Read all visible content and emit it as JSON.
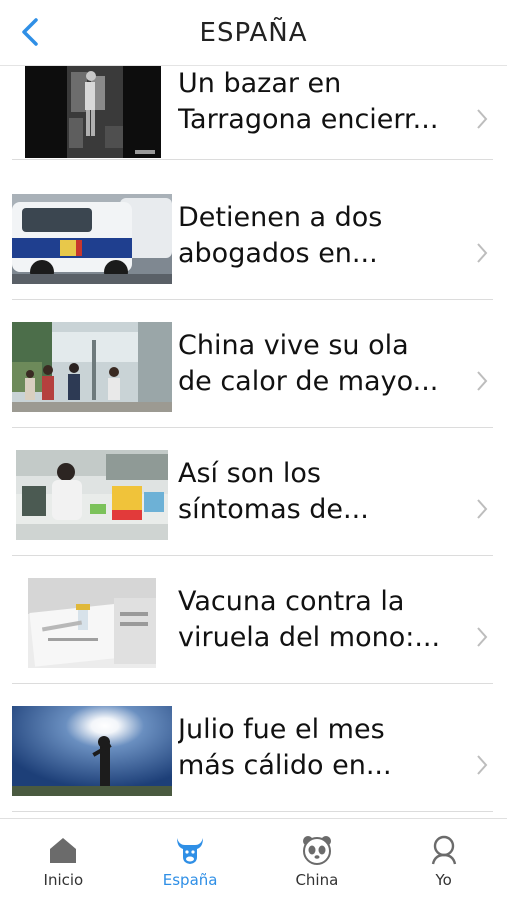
{
  "header": {
    "title": "ESPAÑA",
    "back_icon": "chevron-left-icon",
    "accent": "#2f8fe6"
  },
  "articles": [
    {
      "line1": "Un bazar en",
      "line2": "Tarragona encierr..."
    },
    {
      "line1": "Detienen a dos",
      "line2": "abogados en..."
    },
    {
      "line1": "China vive su ola",
      "line2": "de calor de mayo..."
    },
    {
      "line1": "Así son los",
      "line2": "síntomas de..."
    },
    {
      "line1": "Vacuna contra la",
      "line2": "viruela del mono:..."
    },
    {
      "line1": "Julio fue el mes",
      "line2": "más cálido en..."
    }
  ],
  "tabbar": {
    "tabs": [
      {
        "label": "Inicio",
        "icon": "home-icon"
      },
      {
        "label": "España",
        "icon": "bull-icon",
        "active": true
      },
      {
        "label": "China",
        "icon": "panda-icon"
      },
      {
        "label": "Yo",
        "icon": "user-icon"
      }
    ],
    "active_color": "#2f8fe6",
    "inactive_color": "#6b6b6b"
  }
}
